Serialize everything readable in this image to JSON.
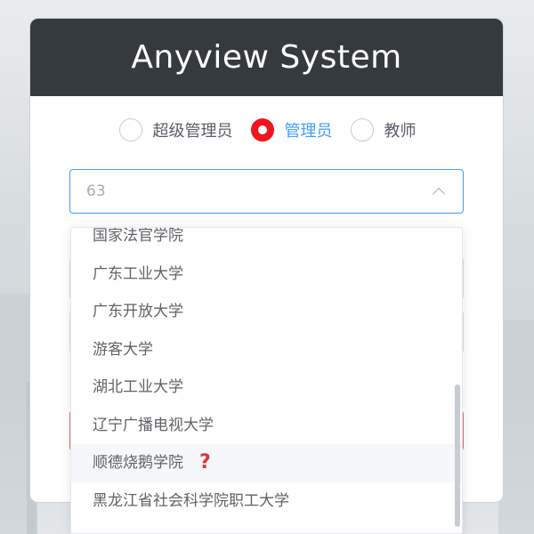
{
  "header": {
    "title": "Anyview System"
  },
  "roles": [
    {
      "label": "超级管理员",
      "checked": false
    },
    {
      "label": "管理员",
      "checked": true
    },
    {
      "label": "教师",
      "checked": false
    }
  ],
  "school_select": {
    "value": "63"
  },
  "dropdown": {
    "items": [
      "国家法官学院",
      "广东工业大学",
      "广东开放大学",
      "游客大学",
      "湖北工业大学",
      "辽宁广播电视大学",
      "顺德烧鹅学院",
      "黑龙江省社会科学院职工大学"
    ],
    "hover_index": 6,
    "hover_icon": "question-mark-icon"
  },
  "colors": {
    "header_bg": "#353a3e",
    "accent": "#409eff",
    "radio_checked": "#f0141e"
  }
}
